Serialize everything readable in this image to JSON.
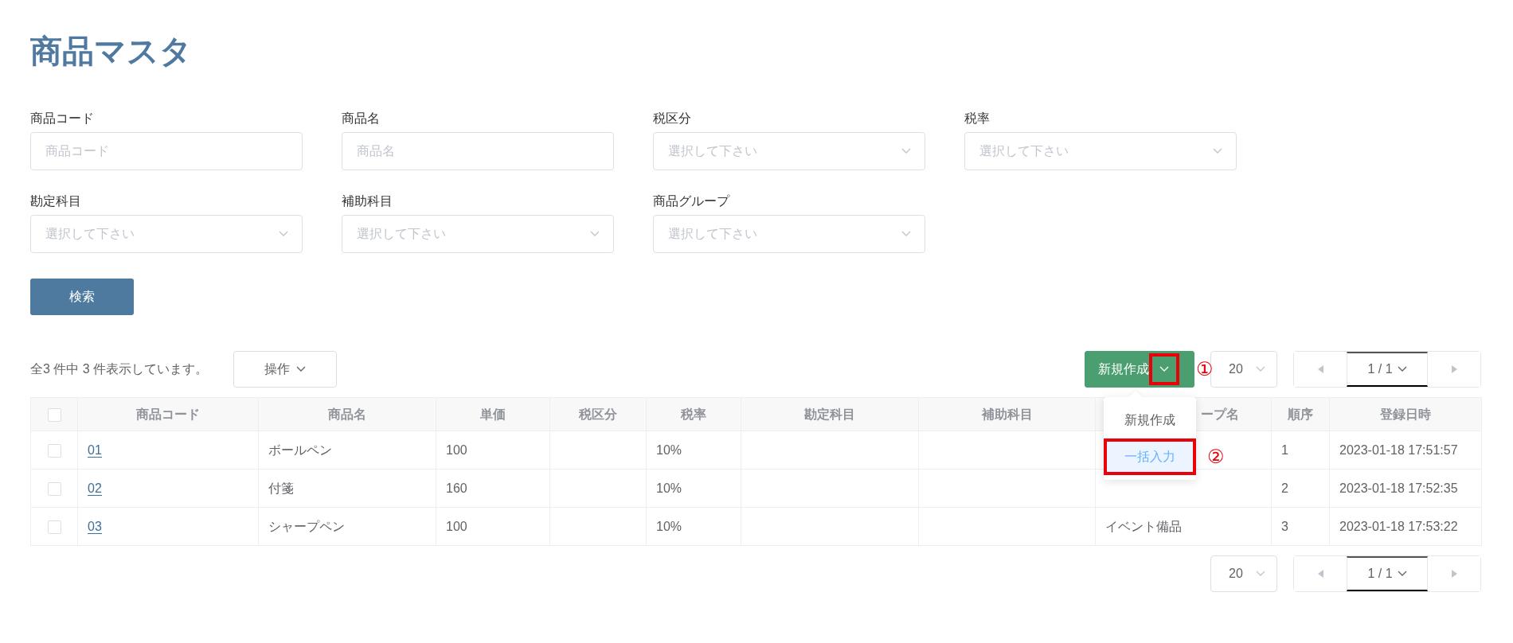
{
  "title": "商品マスタ",
  "filters": [
    {
      "label": "商品コード",
      "kind": "text",
      "placeholder": "商品コード"
    },
    {
      "label": "商品名",
      "kind": "text",
      "placeholder": "商品名"
    },
    {
      "label": "税区分",
      "kind": "select",
      "placeholder": "選択して下さい"
    },
    {
      "label": "税率",
      "kind": "select",
      "placeholder": "選択して下さい"
    },
    {
      "label": "勘定科目",
      "kind": "select",
      "placeholder": "選択して下さい"
    },
    {
      "label": "補助科目",
      "kind": "select",
      "placeholder": "選択して下さい"
    },
    {
      "label": "商品グループ",
      "kind": "select",
      "placeholder": "選択して下さい"
    }
  ],
  "search_button": "検索",
  "summary": "全3 件中 3 件表示しています。",
  "actions_button": "操作",
  "new_button": {
    "label": "新規作成",
    "expanded": true,
    "annotation": "①"
  },
  "new_menu": [
    {
      "label": "新規作成",
      "selected": false
    },
    {
      "label": "一括入力",
      "selected": true,
      "annotation": "②"
    }
  ],
  "top_pager": {
    "page_size": "20",
    "page": "1 / 1"
  },
  "table": {
    "header_checked": false,
    "columns": [
      {
        "label": "商品コード"
      },
      {
        "label": "商品名"
      },
      {
        "label": "単価"
      },
      {
        "label": "税区分"
      },
      {
        "label": "税率"
      },
      {
        "label": "勘定科目"
      },
      {
        "label": "補助科目"
      },
      {
        "label": "ープ名"
      },
      {
        "label": "順序"
      },
      {
        "label": "登録日時"
      }
    ],
    "rows": [
      {
        "checked": false,
        "code": "01",
        "name": "ボールペン",
        "price": "100",
        "tax_rate": "10%",
        "order": "1",
        "registered": "2023-01-18 17:51:57"
      },
      {
        "checked": false,
        "code": "02",
        "name": "付箋",
        "price": "160",
        "tax_rate": "10%",
        "order": "2",
        "registered": "2023-01-18 17:52:35"
      },
      {
        "checked": false,
        "code": "03",
        "name": "シャープペン",
        "price": "100",
        "tax_rate": "10%",
        "group": "イベント備品",
        "order": "3",
        "registered": "2023-01-18 17:53:22"
      }
    ]
  },
  "bottom_pager": {
    "page_size": "20",
    "page": "1 / 1"
  }
}
